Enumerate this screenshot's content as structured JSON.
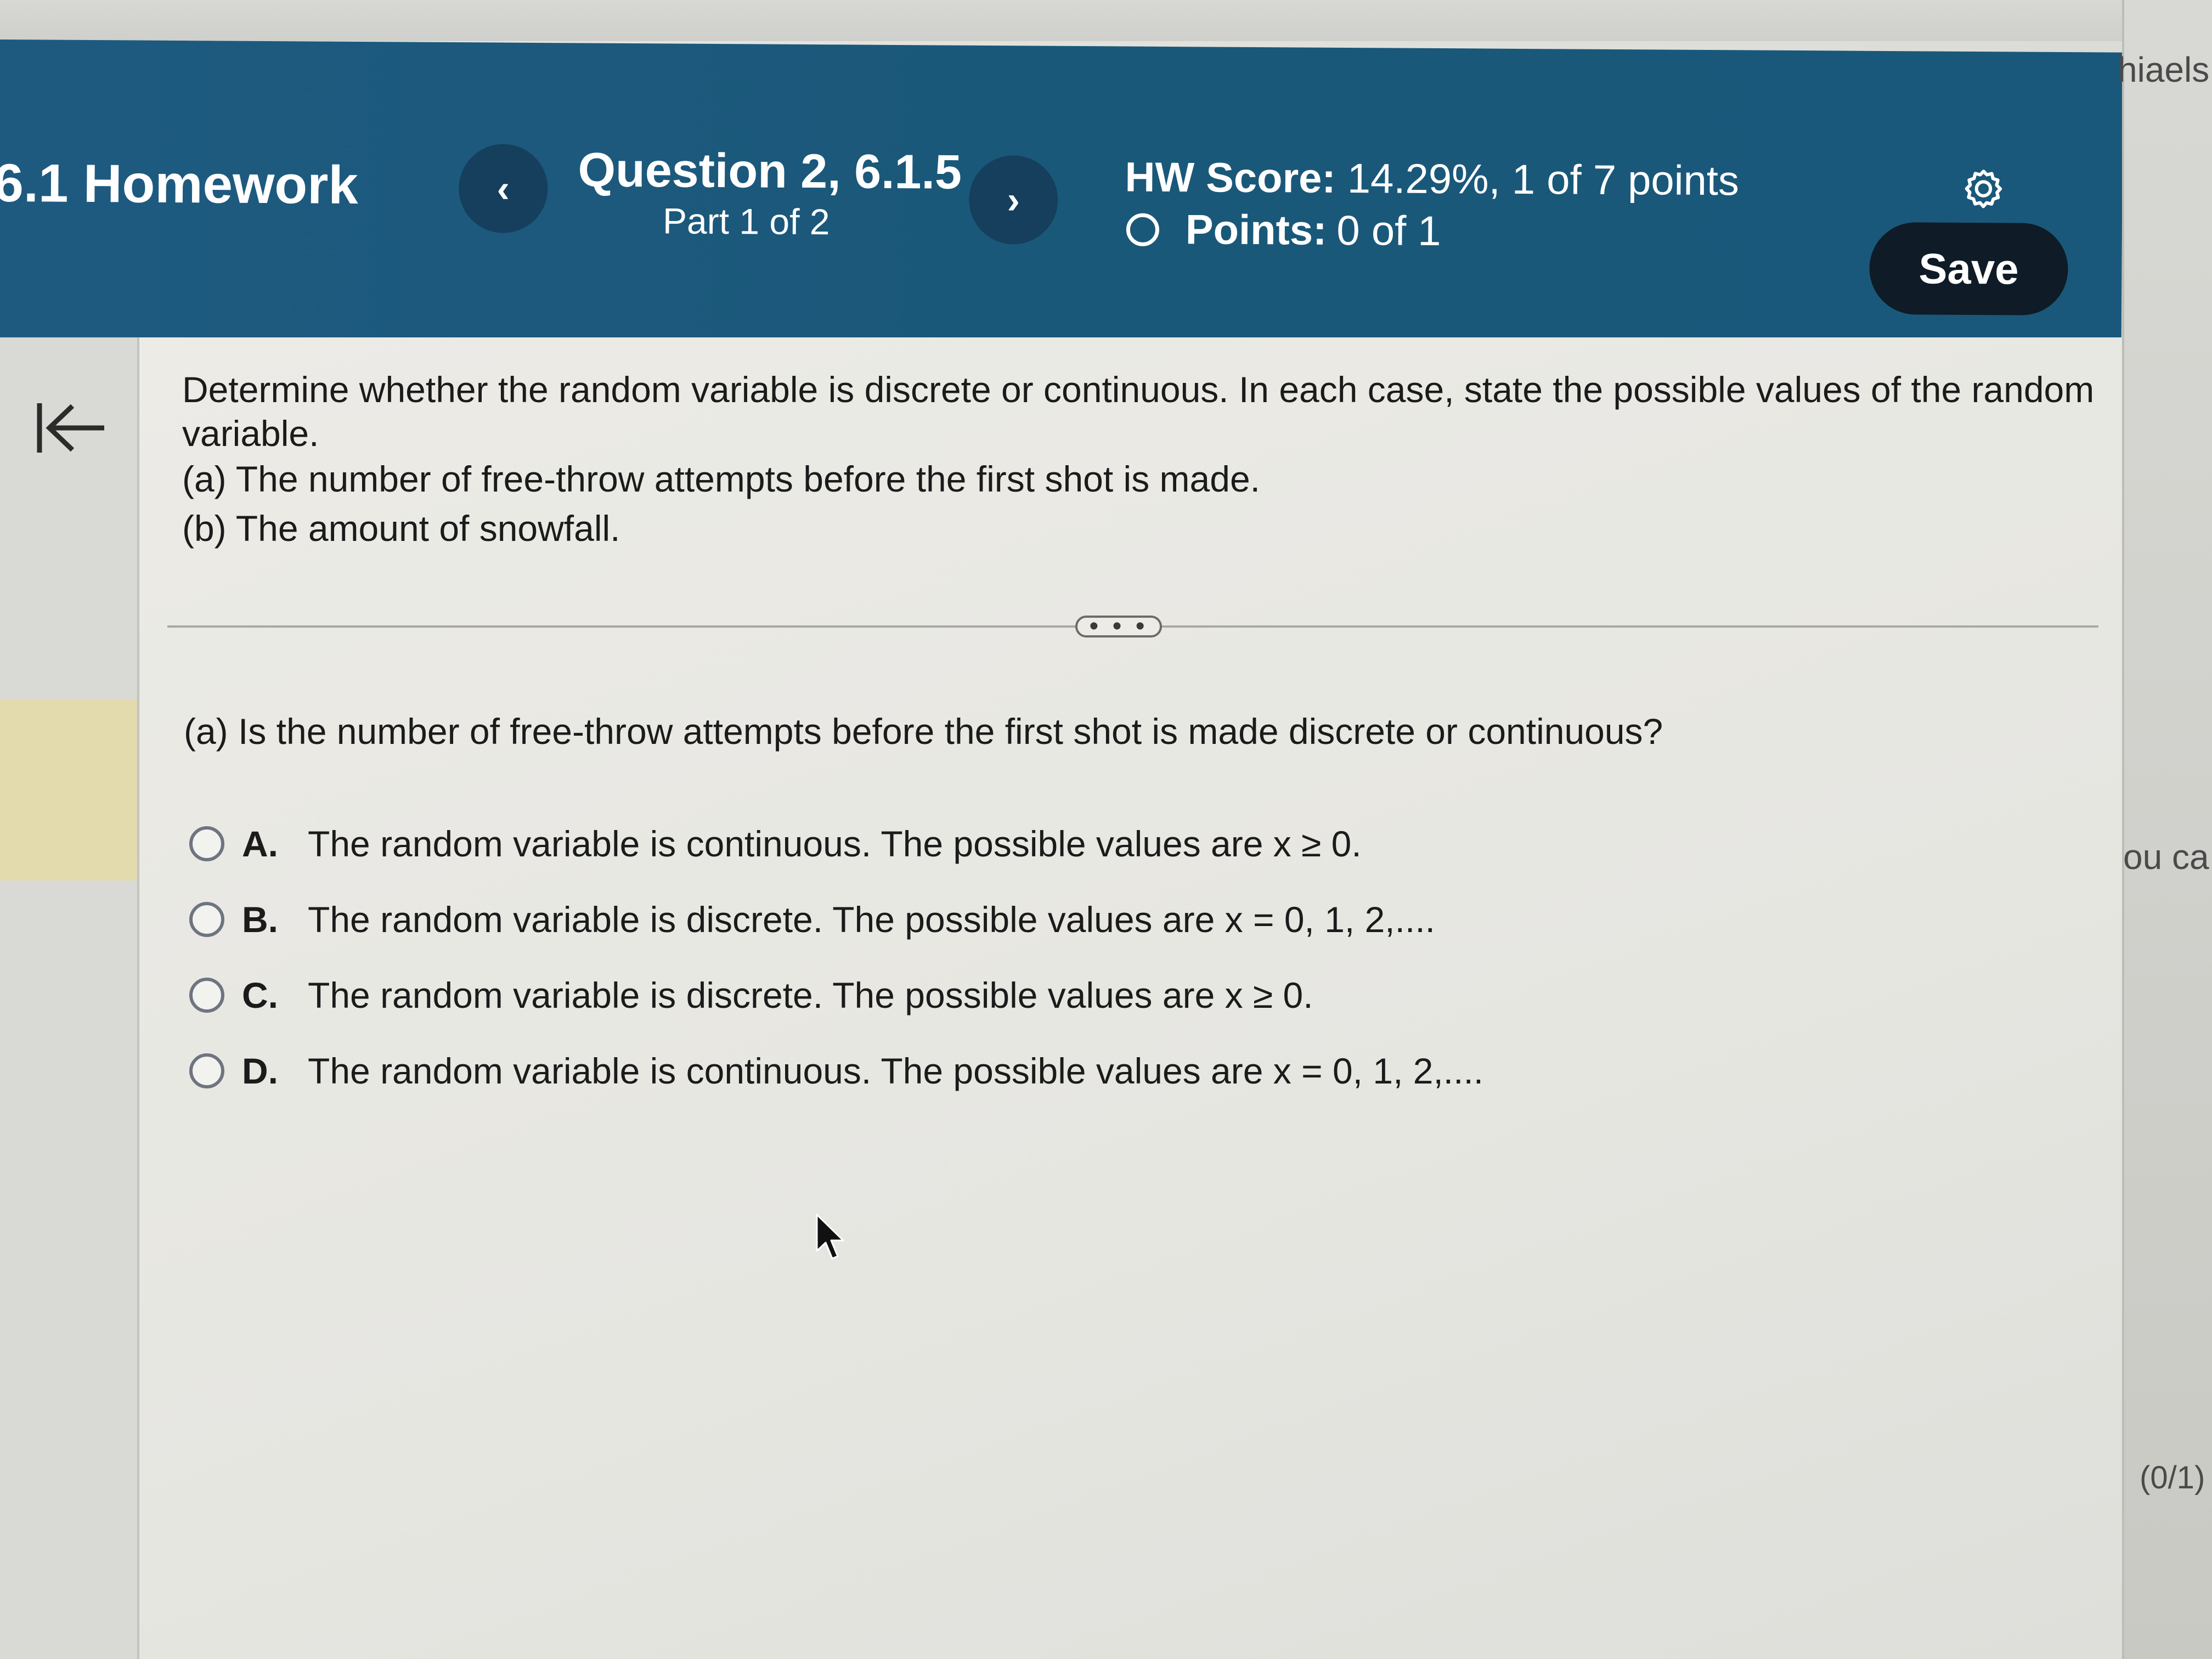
{
  "header": {
    "assignment_title": "6.1 Homework",
    "prev_label": "‹",
    "next_label": "›",
    "question_title": "Question 2, 6.1.5",
    "question_part": "Part 1 of 2",
    "score_label": "HW Score:",
    "score_value": "14.29%, 1 of 7 points",
    "points_label": "Points:",
    "points_value": "0 of 1",
    "save_label": "Save",
    "settings_icon": "gear-icon"
  },
  "edge": {
    "name_fragment": "hiaels",
    "text_fragment": "ou ca",
    "score_fragment": "(0/1)"
  },
  "question": {
    "prompt_line1": "Determine whether the random variable is discrete or continuous. In each case, state the possible values of the random",
    "prompt_line2": "variable.",
    "part_a": "(a) The number of free-throw attempts before the first shot is made.",
    "part_b": "(b) The amount of snowfall.",
    "divider_handle": "• • •",
    "sub_question": "(a) Is the number of free-throw attempts before the first shot is made discrete or continuous?"
  },
  "choices": [
    {
      "letter": "A.",
      "text": "The random variable is continuous. The possible values are x ≥ 0."
    },
    {
      "letter": "B.",
      "text": "The random variable is discrete. The possible values are x = 0, 1, 2,...."
    },
    {
      "letter": "C.",
      "text": "The random variable is discrete. The possible values are x ≥ 0."
    },
    {
      "letter": "D.",
      "text": "The random variable is continuous. The possible values are x = 0, 1, 2,...."
    }
  ],
  "colors": {
    "header_bg": "#1b5a7e",
    "save_bg": "#0f1b26",
    "highlight_tab": "#e3dbae"
  }
}
